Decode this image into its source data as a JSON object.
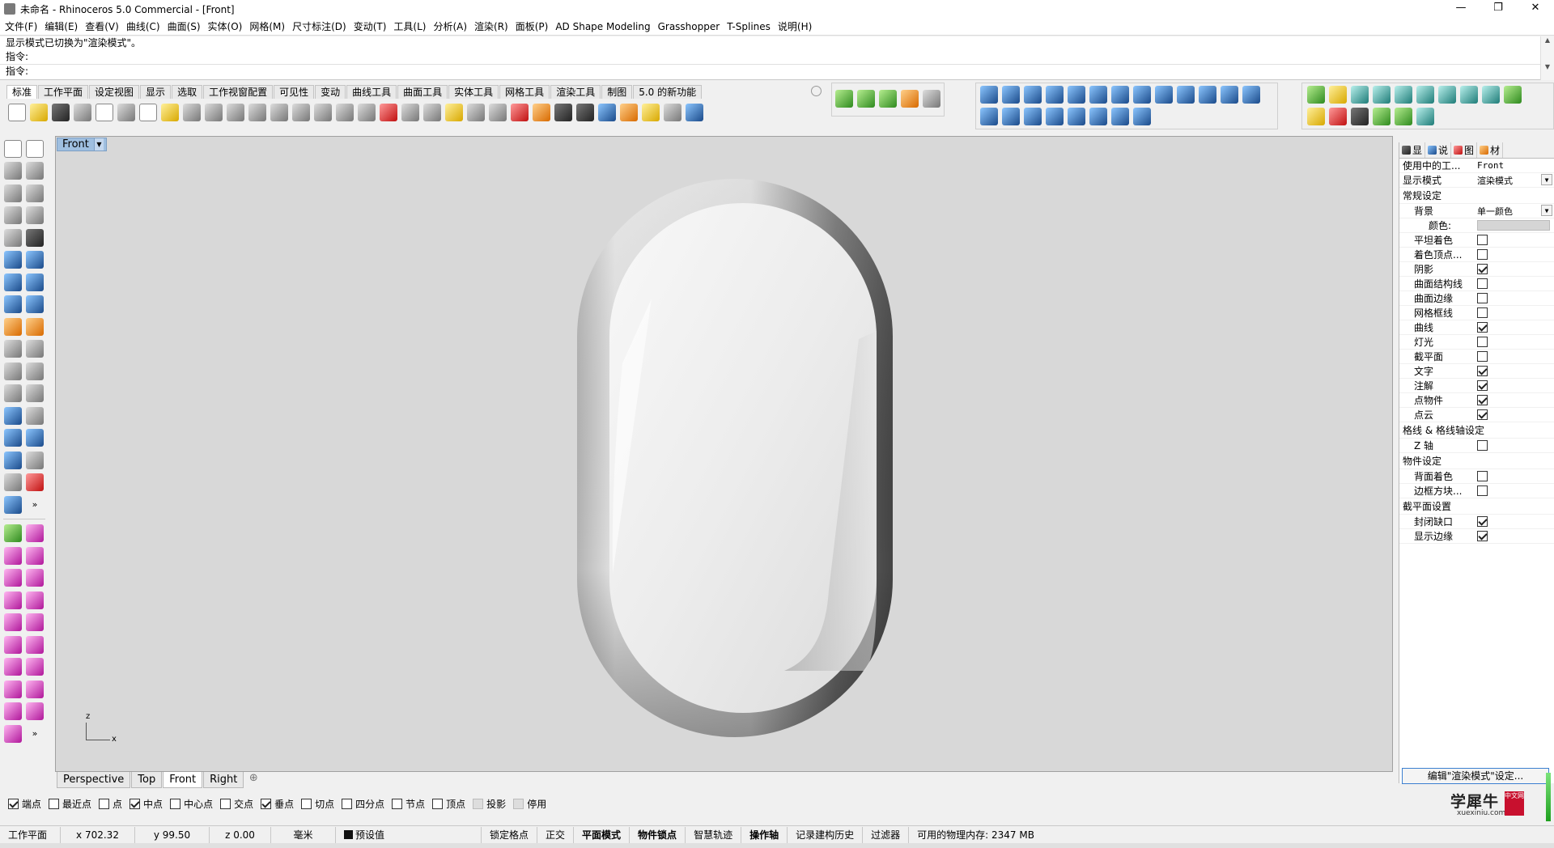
{
  "window": {
    "title": "未命名 - Rhinoceros 5.0 Commercial - [Front]",
    "controls": [
      "—",
      "❐",
      "✕"
    ]
  },
  "menu": [
    "文件(F)",
    "编辑(E)",
    "查看(V)",
    "曲线(C)",
    "曲面(S)",
    "实体(O)",
    "网格(M)",
    "尺寸标注(D)",
    "变动(T)",
    "工具(L)",
    "分析(A)",
    "渲染(R)",
    "面板(P)",
    "AD Shape Modeling",
    "Grasshopper",
    "T-Splines",
    "说明(H)"
  ],
  "command": {
    "history1": "显示模式已切换为\"渲染模式\"。",
    "history2": "指令:",
    "prompt": "指令:",
    "scroll_up": "▲",
    "scroll_down": "▼"
  },
  "toolbar_tabs": [
    "标准",
    "工作平面",
    "设定视图",
    "显示",
    "选取",
    "工作视窗配置",
    "可见性",
    "变动",
    "曲线工具",
    "曲面工具",
    "实体工具",
    "网格工具",
    "渲染工具",
    "制图",
    "5.0 的新功能"
  ],
  "viewport": {
    "label": "Front",
    "dropdown": "▼",
    "axis_z": "z",
    "axis_x": "x",
    "object": {
      "shape": "rounded capsule ring",
      "shading": "rendered grey gradient"
    }
  },
  "view_tabs": [
    "Perspective",
    "Top",
    "Front",
    "Right"
  ],
  "view_tab_add": "⊕",
  "osnaps": [
    {
      "label": "端点",
      "checked": true
    },
    {
      "label": "最近点",
      "checked": false
    },
    {
      "label": "点",
      "checked": false
    },
    {
      "label": "中点",
      "checked": true
    },
    {
      "label": "中心点",
      "checked": false
    },
    {
      "label": "交点",
      "checked": false
    },
    {
      "label": "垂点",
      "checked": true
    },
    {
      "label": "切点",
      "checked": false
    },
    {
      "label": "四分点",
      "checked": false
    },
    {
      "label": "节点",
      "checked": false
    },
    {
      "label": "顶点",
      "checked": false
    },
    {
      "label": "投影",
      "checked": false,
      "disabled": true
    },
    {
      "label": "停用",
      "checked": false,
      "disabled": true
    }
  ],
  "status": {
    "cplane": "工作平面",
    "x": "x 702.32",
    "y": "y 99.50",
    "z": "z 0.00",
    "unit": "毫米",
    "layer": "预设值",
    "grid_snap": "锁定格点",
    "ortho": "正交",
    "planar": "平面模式",
    "osnap": "物件锁点",
    "smarttrack": "智慧轨迹",
    "gumball": "操作轴",
    "history": "记录建构历史",
    "filter": "过滤器",
    "memory": "可用的物理内存: 2347 MB"
  },
  "panel": {
    "tabs": [
      {
        "label": "显",
        "icon": "monitor-icon"
      },
      {
        "label": "说",
        "icon": "help-icon"
      },
      {
        "label": "图",
        "icon": "layers-icon"
      },
      {
        "label": "材",
        "icon": "material-icon"
      }
    ],
    "rows": [
      {
        "label": "使用中的工...",
        "value": "Front",
        "type": "text",
        "top": true
      },
      {
        "label": "显示模式",
        "value": "渲染模式",
        "type": "select",
        "top": true
      }
    ],
    "section_general": "常规设定",
    "background": {
      "label": "背景",
      "value": "单一颜色"
    },
    "color_label": "颜色:",
    "general_checks": [
      {
        "label": "平坦着色",
        "checked": false
      },
      {
        "label": "着色顶点...",
        "checked": false
      },
      {
        "label": "阴影",
        "checked": true
      },
      {
        "label": "曲面结构线",
        "checked": false
      },
      {
        "label": "曲面边缘",
        "checked": false
      },
      {
        "label": "网格框线",
        "checked": false
      },
      {
        "label": "曲线",
        "checked": true
      },
      {
        "label": "灯光",
        "checked": false
      },
      {
        "label": "截平面",
        "checked": false
      },
      {
        "label": "文字",
        "checked": true
      },
      {
        "label": "注解",
        "checked": true
      },
      {
        "label": "点物件",
        "checked": true
      },
      {
        "label": "点云",
        "checked": true
      }
    ],
    "section_grid": "格线 & 格线轴设定",
    "grid_checks": [
      {
        "label": "Z 轴",
        "checked": false
      }
    ],
    "section_object": "物件设定",
    "object_checks": [
      {
        "label": "背面着色",
        "checked": false
      },
      {
        "label": "边框方块...",
        "checked": false
      }
    ],
    "section_clip": "截平面设置",
    "clip_checks": [
      {
        "label": "封闭缺口",
        "checked": true
      },
      {
        "label": "显示边缘",
        "checked": true
      }
    ],
    "edit_button": "编辑\"渲染模式\"设定..."
  },
  "logo": {
    "text": "学犀牛",
    "url": "xuexiniu.com",
    "badge": "中文网"
  }
}
